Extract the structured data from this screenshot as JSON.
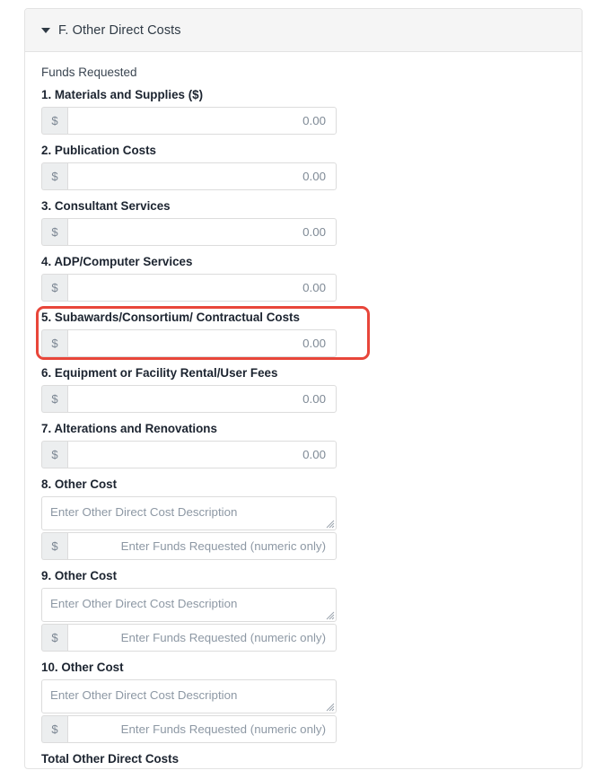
{
  "panel": {
    "header_title": "F. Other Direct Costs",
    "caret_icon": "chevron-down-icon",
    "expanded": true
  },
  "form": {
    "funds_requested_label": "Funds Requested",
    "currency_symbol": "$",
    "total_label": "Total Other Direct Costs",
    "items": [
      {
        "num": "1.",
        "label": "1. Materials and Supplies ($)",
        "type": "money",
        "value": "0.00"
      },
      {
        "num": "2.",
        "label": "2. Publication Costs",
        "type": "money",
        "value": "0.00"
      },
      {
        "num": "3.",
        "label": "3. Consultant Services",
        "type": "money",
        "value": "0.00"
      },
      {
        "num": "4.",
        "label": "4. ADP/Computer Services",
        "type": "money",
        "value": "0.00"
      },
      {
        "num": "5.",
        "label": "5. Subawards/Consortium/ Contractual Costs",
        "type": "money",
        "value": "0.00",
        "highlighted": true
      },
      {
        "num": "6.",
        "label": "6. Equipment or Facility Rental/User Fees",
        "type": "money",
        "value": "0.00"
      },
      {
        "num": "7.",
        "label": "7. Alterations and Renovations",
        "type": "money",
        "value": "0.00"
      },
      {
        "num": "8.",
        "label": "8. Other Cost",
        "type": "other",
        "desc_placeholder": "Enter Other Direct Cost Description",
        "amount_placeholder": "Enter Funds Requested (numeric only)"
      },
      {
        "num": "9.",
        "label": "9. Other Cost",
        "type": "other",
        "desc_placeholder": "Enter Other Direct Cost Description",
        "amount_placeholder": "Enter Funds Requested (numeric only)"
      },
      {
        "num": "10.",
        "label": "10. Other Cost",
        "type": "other",
        "desc_placeholder": "Enter Other Direct Cost Description",
        "amount_placeholder": "Enter Funds Requested (numeric only)"
      }
    ]
  },
  "colors": {
    "highlight": "#e8463a",
    "header_bg": "#f5f5f5",
    "addon_bg": "#eceeef",
    "border": "#dcdcdc",
    "text": "#1c2430"
  }
}
